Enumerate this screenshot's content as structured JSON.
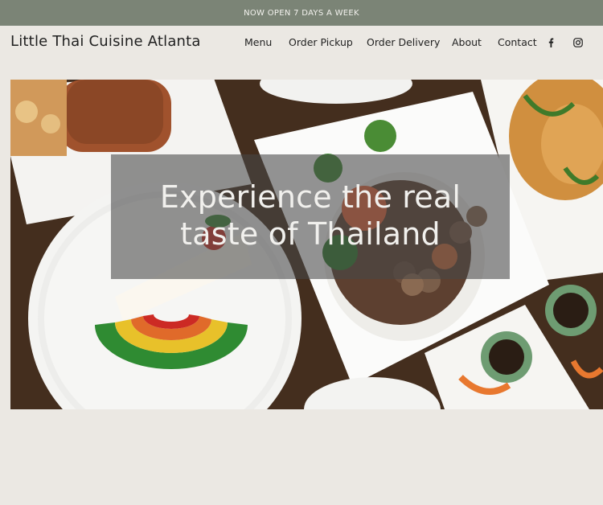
{
  "announcement": "NOW OPEN 7 DAYS A WEEK",
  "brand": "Little Thai Cuisine Atlanta",
  "nav": [
    "Menu",
    "Order Pickup",
    "Order Delivery",
    "About",
    "Contact"
  ],
  "social": [
    "facebook-icon",
    "instagram-icon"
  ],
  "hero": {
    "line1": "Experience the real",
    "line2": "taste of Thailand"
  },
  "colors": {
    "announcement_bar": "#7b8476",
    "page_background": "#ebe8e3",
    "overlay": "#464646"
  }
}
